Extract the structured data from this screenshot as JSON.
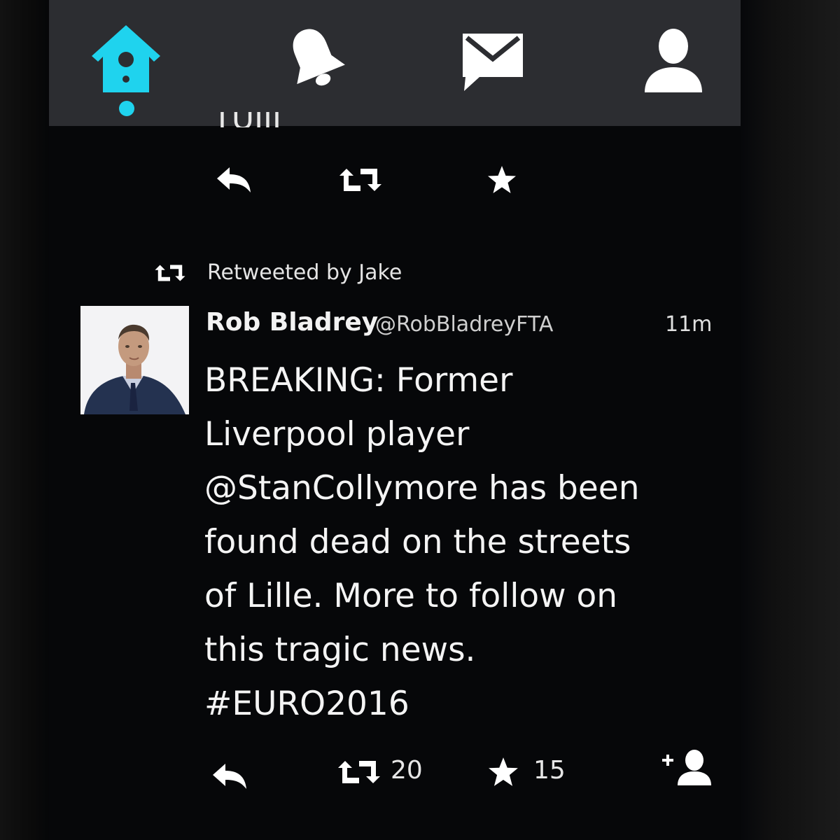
{
  "nav": {
    "items": [
      {
        "name": "home",
        "icon": "birdhouse-icon",
        "active": true
      },
      {
        "name": "notifications",
        "icon": "bell-icon",
        "active": false
      },
      {
        "name": "messages",
        "icon": "envelope-icon",
        "active": false
      },
      {
        "name": "profile",
        "icon": "person-icon",
        "active": false
      }
    ],
    "active_color": "#1fd3ee",
    "icon_color": "#ffffff"
  },
  "previous_tweet": {
    "cut_text": "TUIII"
  },
  "tweet": {
    "retweeted_by": "Retweeted by Jake",
    "author_name": "Rob Bladrey",
    "author_handle": "@RobBladreyFTA",
    "time": "11m",
    "body_lines": [
      "BREAKING: Former",
      "Liverpool player",
      "@StanCollymore has been",
      "found dead on the streets",
      "of Lille. More to follow on",
      "this tragic news.",
      "#EURO2016"
    ],
    "retweet_count": "20",
    "favorite_count": "15"
  }
}
